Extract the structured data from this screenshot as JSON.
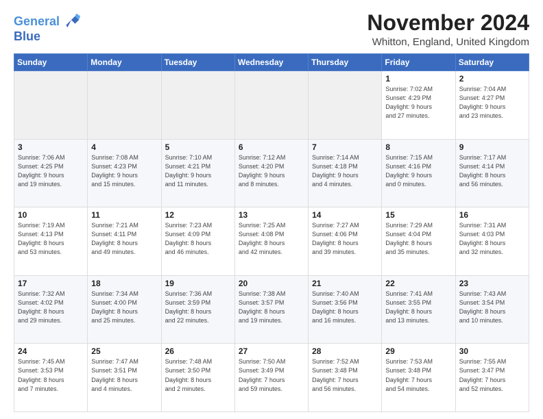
{
  "logo": {
    "line1": "General",
    "line2": "Blue"
  },
  "title": "November 2024",
  "location": "Whitton, England, United Kingdom",
  "headers": [
    "Sunday",
    "Monday",
    "Tuesday",
    "Wednesday",
    "Thursday",
    "Friday",
    "Saturday"
  ],
  "weeks": [
    [
      {
        "day": "",
        "info": ""
      },
      {
        "day": "",
        "info": ""
      },
      {
        "day": "",
        "info": ""
      },
      {
        "day": "",
        "info": ""
      },
      {
        "day": "",
        "info": ""
      },
      {
        "day": "1",
        "info": "Sunrise: 7:02 AM\nSunset: 4:29 PM\nDaylight: 9 hours\nand 27 minutes."
      },
      {
        "day": "2",
        "info": "Sunrise: 7:04 AM\nSunset: 4:27 PM\nDaylight: 9 hours\nand 23 minutes."
      }
    ],
    [
      {
        "day": "3",
        "info": "Sunrise: 7:06 AM\nSunset: 4:25 PM\nDaylight: 9 hours\nand 19 minutes."
      },
      {
        "day": "4",
        "info": "Sunrise: 7:08 AM\nSunset: 4:23 PM\nDaylight: 9 hours\nand 15 minutes."
      },
      {
        "day": "5",
        "info": "Sunrise: 7:10 AM\nSunset: 4:21 PM\nDaylight: 9 hours\nand 11 minutes."
      },
      {
        "day": "6",
        "info": "Sunrise: 7:12 AM\nSunset: 4:20 PM\nDaylight: 9 hours\nand 8 minutes."
      },
      {
        "day": "7",
        "info": "Sunrise: 7:14 AM\nSunset: 4:18 PM\nDaylight: 9 hours\nand 4 minutes."
      },
      {
        "day": "8",
        "info": "Sunrise: 7:15 AM\nSunset: 4:16 PM\nDaylight: 9 hours\nand 0 minutes."
      },
      {
        "day": "9",
        "info": "Sunrise: 7:17 AM\nSunset: 4:14 PM\nDaylight: 8 hours\nand 56 minutes."
      }
    ],
    [
      {
        "day": "10",
        "info": "Sunrise: 7:19 AM\nSunset: 4:13 PM\nDaylight: 8 hours\nand 53 minutes."
      },
      {
        "day": "11",
        "info": "Sunrise: 7:21 AM\nSunset: 4:11 PM\nDaylight: 8 hours\nand 49 minutes."
      },
      {
        "day": "12",
        "info": "Sunrise: 7:23 AM\nSunset: 4:09 PM\nDaylight: 8 hours\nand 46 minutes."
      },
      {
        "day": "13",
        "info": "Sunrise: 7:25 AM\nSunset: 4:08 PM\nDaylight: 8 hours\nand 42 minutes."
      },
      {
        "day": "14",
        "info": "Sunrise: 7:27 AM\nSunset: 4:06 PM\nDaylight: 8 hours\nand 39 minutes."
      },
      {
        "day": "15",
        "info": "Sunrise: 7:29 AM\nSunset: 4:04 PM\nDaylight: 8 hours\nand 35 minutes."
      },
      {
        "day": "16",
        "info": "Sunrise: 7:31 AM\nSunset: 4:03 PM\nDaylight: 8 hours\nand 32 minutes."
      }
    ],
    [
      {
        "day": "17",
        "info": "Sunrise: 7:32 AM\nSunset: 4:02 PM\nDaylight: 8 hours\nand 29 minutes."
      },
      {
        "day": "18",
        "info": "Sunrise: 7:34 AM\nSunset: 4:00 PM\nDaylight: 8 hours\nand 25 minutes."
      },
      {
        "day": "19",
        "info": "Sunrise: 7:36 AM\nSunset: 3:59 PM\nDaylight: 8 hours\nand 22 minutes."
      },
      {
        "day": "20",
        "info": "Sunrise: 7:38 AM\nSunset: 3:57 PM\nDaylight: 8 hours\nand 19 minutes."
      },
      {
        "day": "21",
        "info": "Sunrise: 7:40 AM\nSunset: 3:56 PM\nDaylight: 8 hours\nand 16 minutes."
      },
      {
        "day": "22",
        "info": "Sunrise: 7:41 AM\nSunset: 3:55 PM\nDaylight: 8 hours\nand 13 minutes."
      },
      {
        "day": "23",
        "info": "Sunrise: 7:43 AM\nSunset: 3:54 PM\nDaylight: 8 hours\nand 10 minutes."
      }
    ],
    [
      {
        "day": "24",
        "info": "Sunrise: 7:45 AM\nSunset: 3:53 PM\nDaylight: 8 hours\nand 7 minutes."
      },
      {
        "day": "25",
        "info": "Sunrise: 7:47 AM\nSunset: 3:51 PM\nDaylight: 8 hours\nand 4 minutes."
      },
      {
        "day": "26",
        "info": "Sunrise: 7:48 AM\nSunset: 3:50 PM\nDaylight: 8 hours\nand 2 minutes."
      },
      {
        "day": "27",
        "info": "Sunrise: 7:50 AM\nSunset: 3:49 PM\nDaylight: 7 hours\nand 59 minutes."
      },
      {
        "day": "28",
        "info": "Sunrise: 7:52 AM\nSunset: 3:48 PM\nDaylight: 7 hours\nand 56 minutes."
      },
      {
        "day": "29",
        "info": "Sunrise: 7:53 AM\nSunset: 3:48 PM\nDaylight: 7 hours\nand 54 minutes."
      },
      {
        "day": "30",
        "info": "Sunrise: 7:55 AM\nSunset: 3:47 PM\nDaylight: 7 hours\nand 52 minutes."
      }
    ]
  ]
}
